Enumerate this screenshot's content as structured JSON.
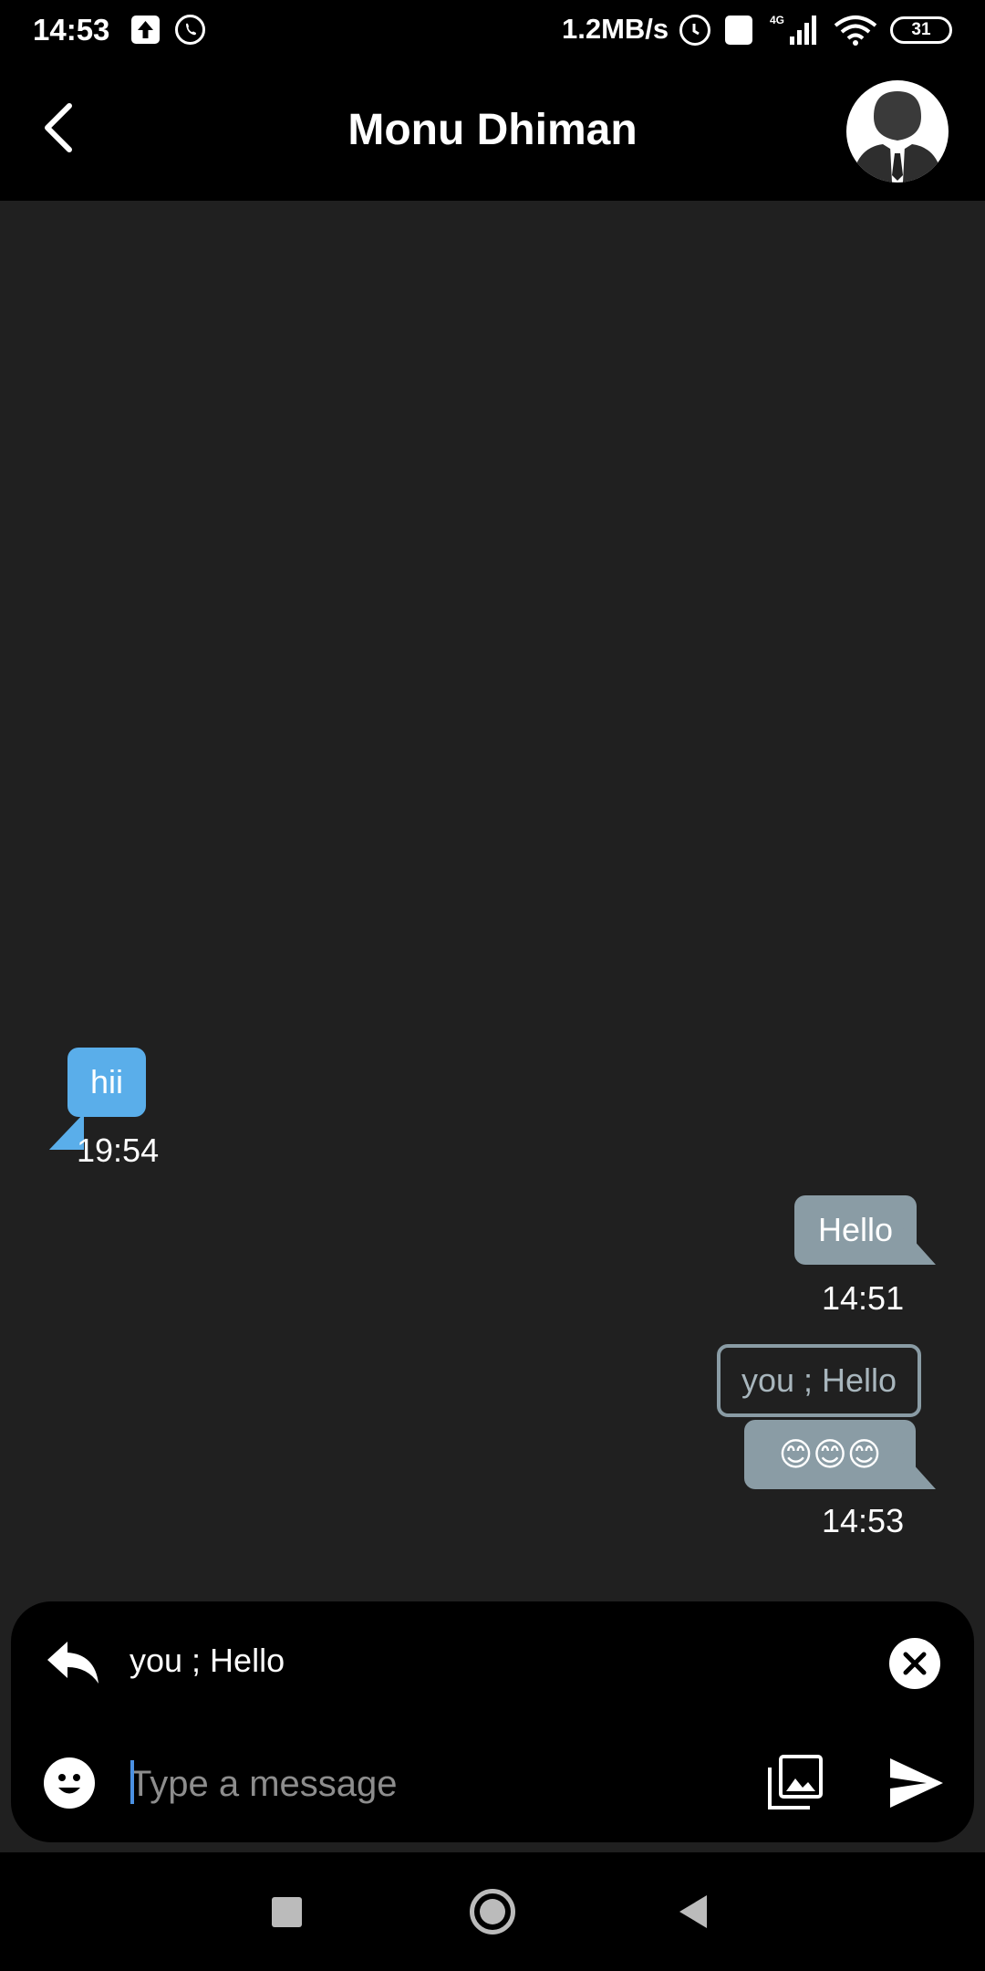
{
  "status_bar": {
    "time": "14:53",
    "net_speed": "1.2MB/s",
    "network": "4G",
    "battery": "31",
    "icons": [
      "upload-icon",
      "whatsapp-icon",
      "alarm-icon",
      "volte-icon",
      "signal-icon",
      "wifi-icon",
      "battery-icon"
    ]
  },
  "header": {
    "contact_name": "Monu Dhiman",
    "back_icon": "chevron-left-icon",
    "avatar_icon": "person-silhouette-icon"
  },
  "messages": [
    {
      "direction": "incoming",
      "text": "hii",
      "time": "19:54"
    },
    {
      "direction": "outgoing",
      "text": "Hello",
      "time": "14:51"
    },
    {
      "direction": "outgoing",
      "reply_to": "you ;  Hello",
      "text": "😊😊😊",
      "time": "14:53"
    }
  ],
  "compose": {
    "reply_preview": "you ;  Hello",
    "placeholder": "Type a message",
    "value": "",
    "icons": [
      "reply-icon",
      "close-icon",
      "emoji-icon",
      "gallery-icon",
      "send-icon"
    ]
  },
  "colors": {
    "incoming_bubble": "#5aaeea",
    "outgoing_bubble": "#8a9ca5",
    "chat_background": "#202020",
    "bars": "#000000"
  }
}
